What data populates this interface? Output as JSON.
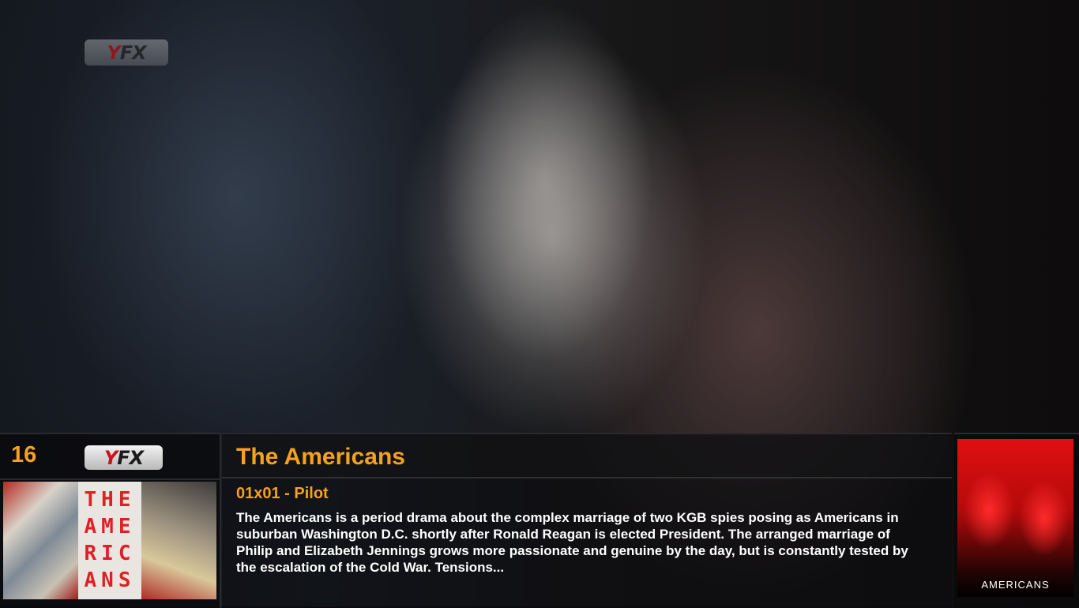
{
  "channel": {
    "number": "16",
    "network_logo": "FX",
    "network_logo_mark": "Y"
  },
  "program": {
    "show_title": "The Americans",
    "episode": "01x01 - Pilot",
    "plot": "The Americans is a period drama about the complex marriage of two KGB spies posing as Americans in suburban Washington D.C. shortly after Ronald Reagan is elected President. The arranged marriage of Philip and Elizabeth Jennings grows more passionate and genuine by the day, but is constantly tested by the escalation of the Cold War. Tensions..."
  },
  "art": {
    "banner_letters": [
      "THE",
      "AME",
      "RIC",
      "ANS"
    ],
    "poster_title": "AMERICANS"
  },
  "colors": {
    "accent": "#f5a21c",
    "text": "#ffffff",
    "logo_red": "#c8151b"
  }
}
